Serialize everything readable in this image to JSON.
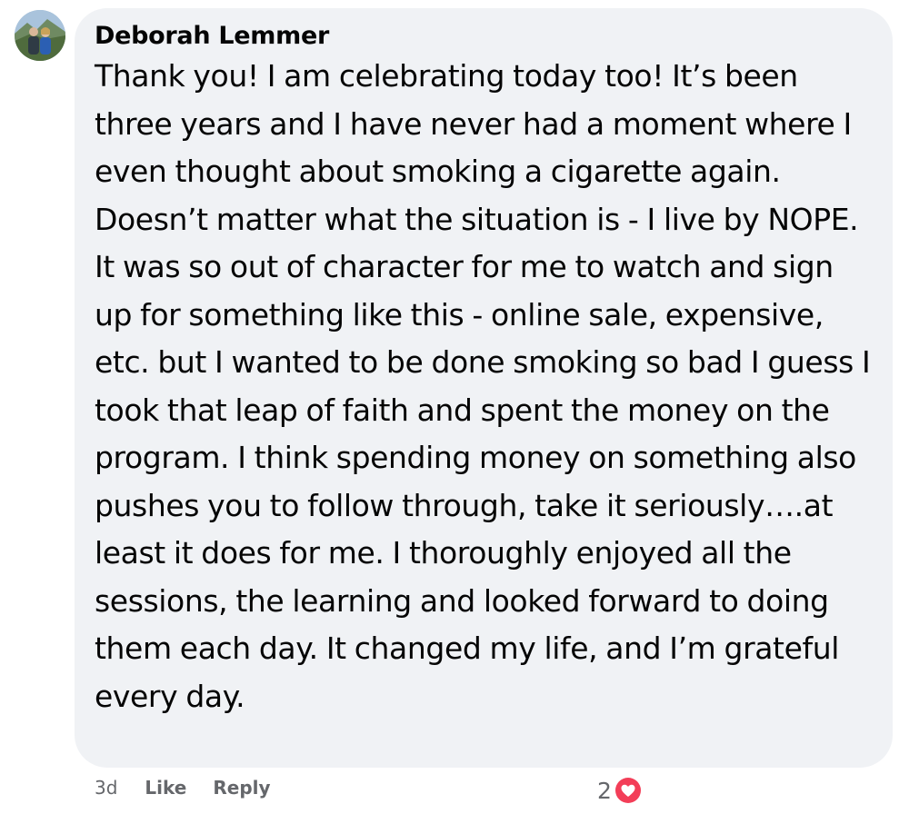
{
  "comment": {
    "author": "Deborah Lemmer",
    "text": "Thank you! I am celebrating today too! It’s been three years and I have never had a moment where I even thought about smoking a cigarette again. Doesn’t matter what the situation is - I live by NOPE. It was so out of character for me to watch and sign up for something like this - online sale, expensive, etc. but I wanted to be done smoking so bad I guess I took that leap of faith and spent the money on the program. I think spending money on something also pushes you to follow through, take it seriously….at least it does for me. I thoroughly enjoyed all the sessions, the learning and looked forward to doing them each day. It changed my life, and I’m grateful every day."
  },
  "actions": {
    "time": "3d",
    "like_label": "Like",
    "reply_label": "Reply"
  },
  "reactions": {
    "count": "2",
    "icon": "heart-icon",
    "color": "#f33e58"
  },
  "colors": {
    "bubble": "#f0f2f5",
    "text": "#050505",
    "secondary": "#65676b"
  }
}
